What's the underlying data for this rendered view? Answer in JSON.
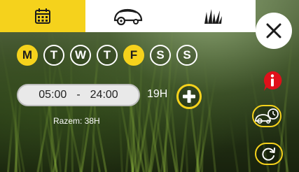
{
  "tabs": [
    {
      "icon": "calendar-icon",
      "active": true
    },
    {
      "icon": "mower-icon",
      "active": false
    },
    {
      "icon": "grass-icon",
      "active": false
    }
  ],
  "close_icon": "close-icon",
  "days": [
    {
      "label": "M",
      "active": true
    },
    {
      "label": "T",
      "active": false
    },
    {
      "label": "W",
      "active": false
    },
    {
      "label": "T",
      "active": false
    },
    {
      "label": "F",
      "active": true
    },
    {
      "label": "S",
      "active": false
    },
    {
      "label": "S",
      "active": false
    }
  ],
  "slot": {
    "start": "05:00",
    "separator": "-",
    "end": "24:00",
    "duration": "19H"
  },
  "total_label": "Razem: 38H",
  "side_buttons": [
    "info-icon",
    "mower-schedule-icon",
    "refresh-icon"
  ],
  "colors": {
    "accent": "#f5d21c",
    "alert": "#e0101a",
    "white": "#ffffff"
  }
}
